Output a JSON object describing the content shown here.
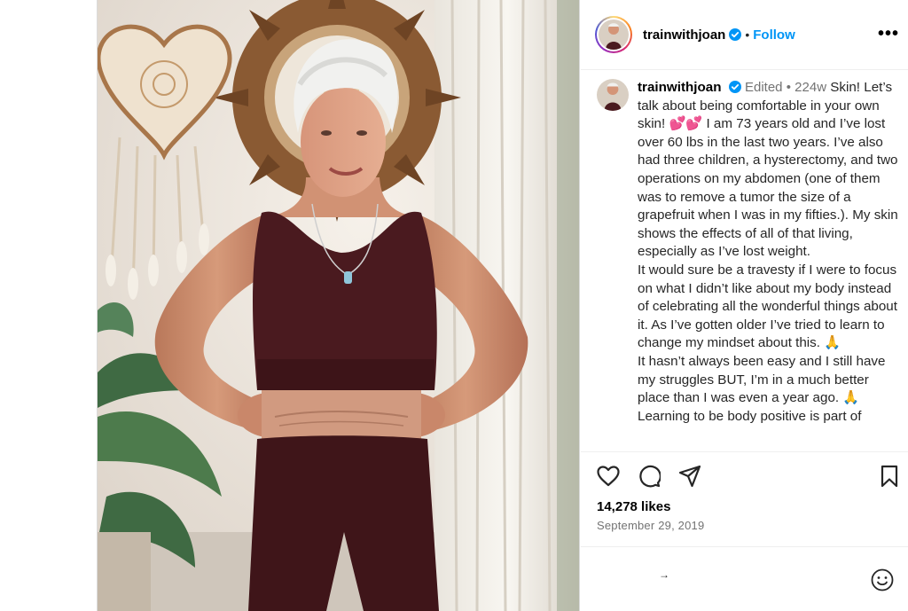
{
  "post": {
    "username": "trainwithjoan",
    "follow_label": "Follow",
    "more_label": "•••",
    "edited_label": "Edited",
    "age": "224w",
    "caption": "Skin! Let’s talk about being comfortable in your own skin! 💕💕 I am 73 years old and I’ve lost over 60 lbs in the last two years. I’ve also had three children, a hysterectomy, and two operations on my abdomen (one of them was to remove a tumor the size of a grapefruit when I was in my fifties.). My skin shows the effects of all of that living, especially as I’ve lost weight.\nIt would sure be a travesty if I were to focus on what I didn’t like about my body instead of celebrating all the wonderful things about it. As I’ve gotten older I’ve tried to learn to change my mindset about this. 🙏\nIt hasn’t always been easy and I still have my struggles BUT, I’m in a much better place than I was even a year ago. 🙏\nLearning to be body positive is part of",
    "likes": "14,278 likes",
    "date": "September 29, 2019",
    "comment_arrow": "→"
  },
  "colors": {
    "accent": "#0095f6",
    "muted": "#737373",
    "top_color": "#4a1a1f",
    "leggings_color": "#3f1519"
  },
  "icons": [
    "verified-badge-icon",
    "more-options-icon",
    "heart-icon",
    "comment-icon",
    "share-icon",
    "bookmark-icon",
    "emoji-icon"
  ]
}
